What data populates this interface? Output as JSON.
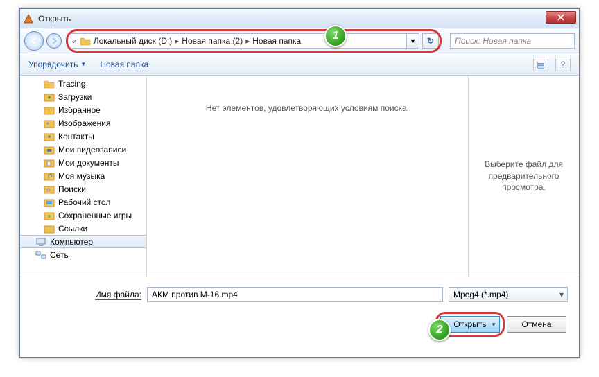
{
  "title": "Открыть",
  "breadcrumb": {
    "prefix": "«",
    "parts": [
      "Локальный диск (D:)",
      "Новая папка (2)",
      "Новая папка"
    ]
  },
  "search": {
    "placeholder": "Поиск: Новая папка"
  },
  "toolbar": {
    "organize": "Упорядочить",
    "newfolder": "Новая папка"
  },
  "sidebar": [
    {
      "label": "Tracing",
      "icon": "folder",
      "lvl": 1
    },
    {
      "label": "Загрузки",
      "icon": "downloads",
      "lvl": 1
    },
    {
      "label": "Избранное",
      "icon": "fav",
      "lvl": 1
    },
    {
      "label": "Изображения",
      "icon": "pic",
      "lvl": 1
    },
    {
      "label": "Контакты",
      "icon": "contact",
      "lvl": 1
    },
    {
      "label": "Мои видеозаписи",
      "icon": "video",
      "lvl": 1
    },
    {
      "label": "Мои документы",
      "icon": "docs",
      "lvl": 1
    },
    {
      "label": "Моя музыка",
      "icon": "music",
      "lvl": 1
    },
    {
      "label": "Поиски",
      "icon": "search",
      "lvl": 1
    },
    {
      "label": "Рабочий стол",
      "icon": "desktop",
      "lvl": 1
    },
    {
      "label": "Сохраненные игры",
      "icon": "games",
      "lvl": 1
    },
    {
      "label": "Ссылки",
      "icon": "links",
      "lvl": 1
    },
    {
      "label": "Компьютер",
      "icon": "computer",
      "lvl": 0,
      "sel": true
    },
    {
      "label": "Сеть",
      "icon": "network",
      "lvl": 0
    }
  ],
  "main": {
    "empty": "Нет элементов, удовлетворяющих условиям поиска.",
    "preview": "Выберите файл для предварительного просмотра."
  },
  "file": {
    "label": "Имя файла:",
    "value": "АКМ против М-16.mp4",
    "filter": "Mpeg4 (*.mp4)"
  },
  "buttons": {
    "open": "Открыть",
    "cancel": "Отмена"
  },
  "callouts": {
    "c1": "1",
    "c2": "2"
  }
}
